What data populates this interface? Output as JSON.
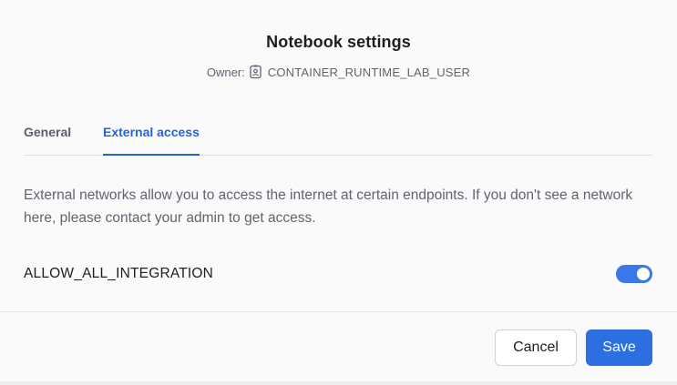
{
  "dialog": {
    "title": "Notebook settings",
    "owner_label": "Owner:",
    "owner_icon": "user-badge-icon",
    "owner_name": "CONTAINER_RUNTIME_LAB_USER"
  },
  "tabs": [
    {
      "label": "General",
      "active": false
    },
    {
      "label": "External access",
      "active": true
    }
  ],
  "external_access": {
    "description": "External networks allow you to access the internet at certain endpoints. If you don't see a network here, please contact your admin to get access.",
    "integrations": [
      {
        "name": "ALLOW_ALL_INTEGRATION",
        "enabled": true
      }
    ]
  },
  "footer": {
    "cancel_label": "Cancel",
    "save_label": "Save"
  },
  "colors": {
    "accent": "#2b6fe0",
    "toggle_on": "#3b78e7",
    "text_primary": "#1d1e24",
    "text_secondary": "#5f6470"
  }
}
